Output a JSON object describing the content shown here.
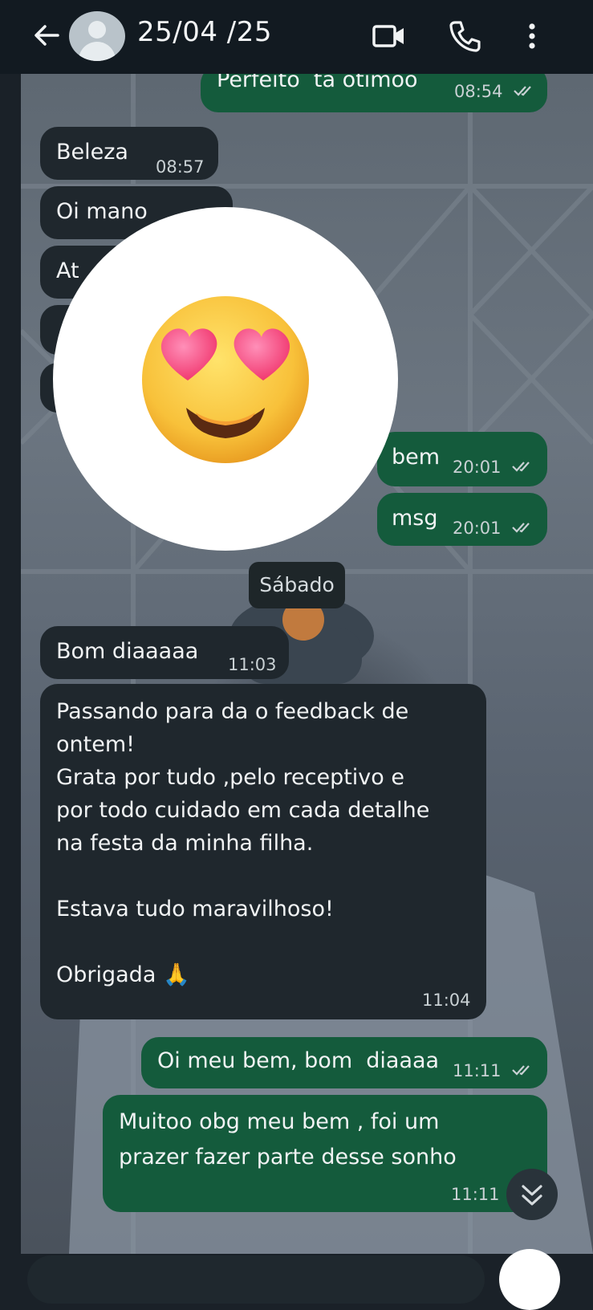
{
  "header": {
    "title": "25/04 /25",
    "back_icon": "arrow-left-icon",
    "avatar_icon": "default-avatar-icon",
    "actions": [
      "video-call-icon",
      "phone-icon",
      "more-vert-icon"
    ]
  },
  "messages": [
    {
      "dir": "out",
      "text": "Perfeito  tá otimoo",
      "time": "08:54",
      "status": "read"
    },
    {
      "dir": "in",
      "text": "Beleza",
      "time": "08:57"
    },
    {
      "dir": "in",
      "text": "Oi mano",
      "time": ""
    },
    {
      "dir": "in",
      "text": "At",
      "time": ""
    },
    {
      "dir": "out",
      "text": "bem",
      "time": "20:01",
      "status": "read"
    },
    {
      "dir": "out",
      "text": "msg",
      "time": "20:01",
      "status": "read"
    },
    {
      "dir": "in",
      "text": "Bom diaaaaa",
      "time": "11:03"
    },
    {
      "dir": "in",
      "text": "Passando para da o feedback de\nontem!\nGrata por tudo ,pelo receptivo e\npor todo cuidado em cada detalhe\nna festa da minha filha.\n\nEstava tudo maravilhoso!\n\nObrigada 🙏",
      "time": "11:04"
    },
    {
      "dir": "out",
      "text": "Oi meu bem, bom  diaaaa",
      "time": "11:11",
      "status": "read"
    },
    {
      "dir": "out",
      "text": "Muitoo obg meu bem , foi um\nprazer fazer parte desse sonho",
      "time": "11:11",
      "status": "read"
    }
  ],
  "date_chip": "Sábado",
  "overlay_emoji": "smiling-face-with-heart-eyes-emoji",
  "scroll_button_icon": "double-chevron-down-icon",
  "colors": {
    "header_bg": "#121a21",
    "incoming_bubble": "#1f272d",
    "outgoing_bubble": "#145b3c",
    "text": "#f1f3f4"
  }
}
